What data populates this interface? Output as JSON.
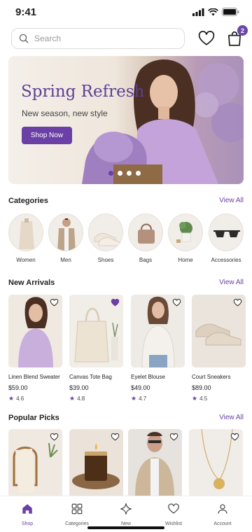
{
  "status": {
    "time": "9:41"
  },
  "search": {
    "placeholder": "Search"
  },
  "cart": {
    "count": "2"
  },
  "hero": {
    "title": "Spring Refresh",
    "subtitle": "New season, new style",
    "cta": "Shop Now",
    "slides": 4,
    "active_slide": 1
  },
  "categories": {
    "heading": "Categories",
    "view_all": "View All",
    "items": [
      {
        "label": "Women"
      },
      {
        "label": "Men"
      },
      {
        "label": "Shoes"
      },
      {
        "label": "Bags"
      },
      {
        "label": "Home"
      },
      {
        "label": "Accessories"
      }
    ]
  },
  "new_arrivals": {
    "heading": "New Arrivals",
    "view_all": "View All",
    "items": [
      {
        "name": "Linen Blend Sweater",
        "price": "$59.00",
        "rating": "4.6",
        "favorited": false
      },
      {
        "name": "Canvas Tote Bag",
        "price": "$39.00",
        "rating": "4.8",
        "favorited": true
      },
      {
        "name": "Eyelet Blouse",
        "price": "$49.00",
        "rating": "4.7",
        "favorited": false
      },
      {
        "name": "Court Sneakers",
        "price": "$89.00",
        "rating": "4.5",
        "favorited": false
      }
    ]
  },
  "popular_picks": {
    "heading": "Popular Picks",
    "view_all": "View All"
  },
  "nav": {
    "items": [
      {
        "label": "Shop",
        "icon": "home-icon",
        "active": true
      },
      {
        "label": "Categories",
        "icon": "grid-icon",
        "active": false
      },
      {
        "label": "New",
        "icon": "sparkle-icon",
        "active": false
      },
      {
        "label": "Wishlist",
        "icon": "heart-icon",
        "active": false
      },
      {
        "label": "Account",
        "icon": "user-icon",
        "active": false
      }
    ]
  },
  "colors": {
    "accent": "#6a3fa6"
  }
}
